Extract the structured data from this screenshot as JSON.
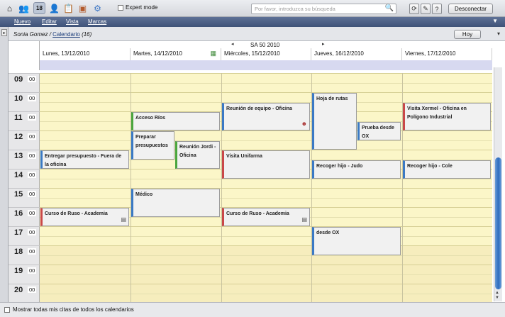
{
  "toolbar": {
    "icons": [
      "home-icon",
      "people-icon",
      "calendar-icon",
      "contacts-icon",
      "notes-icon",
      "briefcase-icon",
      "settings-icon"
    ],
    "expert_mode_label": "Expert mode",
    "search_placeholder": "Por favor, introduzca su búsqueda",
    "disconnect_label": "Desconectar"
  },
  "menu": {
    "items": [
      "Nuevo",
      "Editar",
      "Vista",
      "Marcas"
    ]
  },
  "breadcrumb": {
    "user": "Sonia Gomez",
    "separator": " / ",
    "calendar_link": "Calendario",
    "count": " (16)"
  },
  "today_button": "Hoy",
  "week_label": "SA 50 2010",
  "days": [
    "Lunes, 13/12/2010",
    "Martes, 14/12/2010",
    "Miércoles, 15/12/2010",
    "Jueves, 16/12/2010",
    "Viernes, 17/12/2010"
  ],
  "hours": [
    "09",
    "10",
    "11",
    "12",
    "13",
    "14",
    "15",
    "16",
    "17",
    "18",
    "19",
    "20"
  ],
  "minutes_label": "00",
  "appointments": [
    {
      "title": "Entregar presupuesto - Fuera de la oficina",
      "day": 0,
      "start": "13:00",
      "end": "14:00",
      "color": "#3a79c4"
    },
    {
      "title": "Curso de Ruso - Academia",
      "day": 0,
      "start": "16:00",
      "end": "17:00",
      "color": "#c94848",
      "icon": "document-icon"
    },
    {
      "title": "Acceso Ríos",
      "day": 1,
      "start": "11:00",
      "end": "12:00",
      "color": "#4aa53d"
    },
    {
      "title": "Preparar presupuestos",
      "day": 1,
      "start": "12:00",
      "end": "13:30",
      "color": "#3a79c4"
    },
    {
      "title": "Reunión Jordi - Oficina",
      "day": 1,
      "start": "12:30",
      "end": "14:00",
      "color": "#4aa53d"
    },
    {
      "title": "Médico",
      "day": 1,
      "start": "15:00",
      "end": "16:30",
      "color": "#3a79c4"
    },
    {
      "title": "Reunión de equipo - Oficina",
      "day": 2,
      "start": "10:30",
      "end": "12:00",
      "color": "#3a79c4",
      "icon": "person-icon"
    },
    {
      "title": "Visita Unifarma",
      "day": 2,
      "start": "13:00",
      "end": "14:30",
      "color": "#c94848"
    },
    {
      "title": "Curso de Ruso - Academia",
      "day": 2,
      "start": "16:00",
      "end": "17:00",
      "color": "#c94848",
      "icon": "document-icon"
    },
    {
      "title": "Hoja de rutas",
      "day": 3,
      "start": "10:00",
      "end": "13:00",
      "color": "#3a79c4"
    },
    {
      "title": "Prueba desde OX",
      "day": 3,
      "start": "11:30",
      "end": "12:30",
      "color": "#3a79c4"
    },
    {
      "title": "Recoger hijo - Judo",
      "day": 3,
      "start": "13:30",
      "end": "14:30",
      "color": "#3a79c4"
    },
    {
      "title": "desde OX",
      "day": 3,
      "start": "17:00",
      "end": "18:30",
      "color": "#3a79c4"
    },
    {
      "title": "Visita Xermel - Oficina en Polígono Industrial",
      "day": 4,
      "start": "10:30",
      "end": "12:00",
      "color": "#c94848"
    },
    {
      "title": "Recoger hijo - Cole",
      "day": 4,
      "start": "13:30",
      "end": "14:30",
      "color": "#3a79c4"
    }
  ],
  "footer_label": "Mostrar todas mis citas de todos los calendarios",
  "colors": {
    "work_hours": "#fbf6c8",
    "off_hours": "#f6edbd",
    "menu_bar": "#4a5e84"
  }
}
